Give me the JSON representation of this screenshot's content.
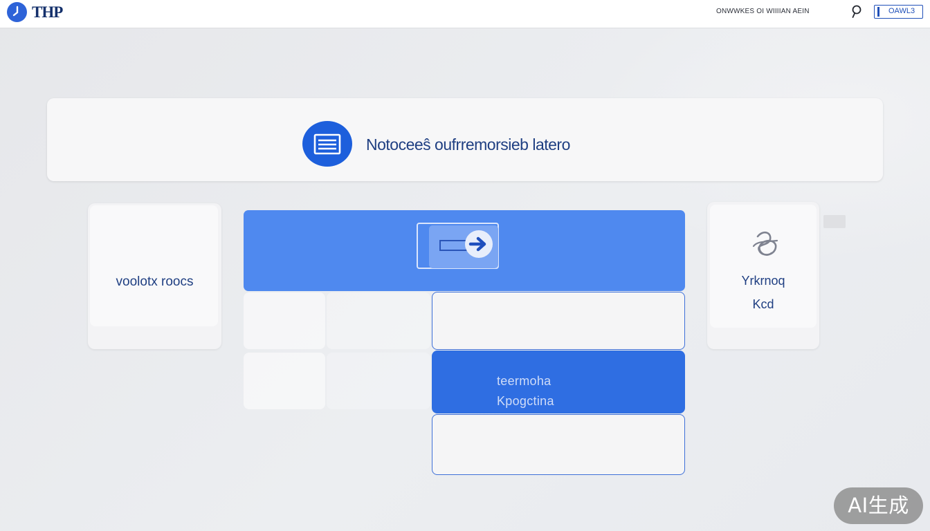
{
  "topbar": {
    "brand": "THP",
    "link": "ONWWKES OI WIIIIAN AEIN",
    "account_label": "OAWL3",
    "search_icon": "search-icon",
    "account_icon": "account-icon"
  },
  "header": {
    "icon": "document-icon",
    "title": "Notoceeŝ oufrremorsieb latero"
  },
  "left_card": {
    "label": "voolotx roocs"
  },
  "main_panel": {
    "icon": "card-forward-icon",
    "options": [
      {
        "lines": [
          "",
          ""
        ],
        "state": "outlined"
      },
      {
        "lines": [
          "teermoha",
          "Kpogctina"
        ],
        "state": "selected"
      },
      {
        "lines": [
          "",
          ""
        ],
        "state": "outlined"
      }
    ]
  },
  "right_card": {
    "icon": "tangle-icon",
    "line1": "Yrkrnoq",
    "line2": "Kcd"
  },
  "badge": {
    "label": "AI生成"
  },
  "colors": {
    "accent": "#4f89ef",
    "selected": "#2f6ee2",
    "brand_blue": "#1d5fdc",
    "text_blue": "#1f3f82"
  }
}
